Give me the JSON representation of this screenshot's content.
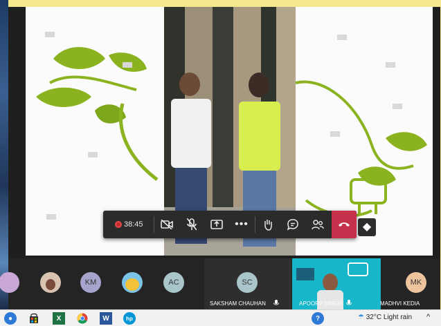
{
  "meeting": {
    "timer": "38:45",
    "toolbar_icons": [
      "record-dot",
      "camera-off-icon",
      "mic-off-icon",
      "share-screen-icon",
      "more-icon",
      "raise-hand-icon",
      "chat-icon",
      "participants-icon",
      "hang-up-icon"
    ]
  },
  "watermark": {
    "line1": "Wondershare",
    "line2": "Filmora"
  },
  "participants": [
    {
      "initials": "KM",
      "color": "#a6a3cc"
    },
    {
      "initials": "AC",
      "color": "#a8c6c9"
    },
    {
      "initials": "SC",
      "color": "#a8c6c9"
    },
    {
      "initials": "MK",
      "color": "#eec49c"
    }
  ],
  "participant_names": {
    "saksham": "SAKSHAM CHAUHAN",
    "apoorv": "APOORV SINGH",
    "madhvi": "MADHVI KEDIA"
  },
  "left_panel_label": "›",
  "taskbar": {
    "temperature": "32°C",
    "weather": "Light rain",
    "help_badge": "?",
    "chevron": "^"
  },
  "colors": {
    "accent": "#c4314b",
    "toolbar": "#2b2b2b",
    "leaf": "#8bb31f"
  }
}
